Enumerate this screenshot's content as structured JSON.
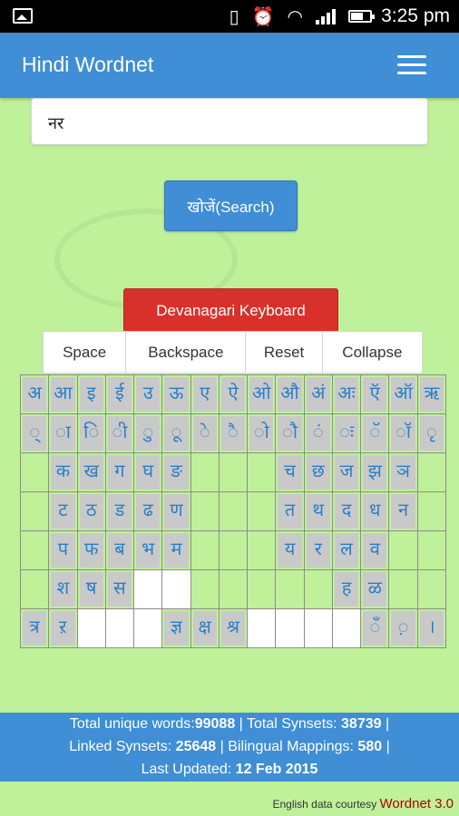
{
  "status_bar": {
    "time": "3:25 pm"
  },
  "app_bar": {
    "title": "Hindi Wordnet"
  },
  "search": {
    "value": "नर",
    "button_label": "खोजें(Search)"
  },
  "keyboard": {
    "toggle_label": "Devanagari Keyboard",
    "actions": [
      "Space",
      "Backspace",
      "Reset",
      "Collapse"
    ],
    "rows": [
      [
        "अ",
        "आ",
        "इ",
        "ई",
        "उ",
        "ऊ",
        "ए",
        "ऐ",
        "ओ",
        "औ",
        "अं",
        "अः",
        "ऍ",
        "ऑ",
        "ऋ"
      ],
      [
        "्",
        "ा",
        "ि",
        "ी",
        "ु",
        "ू",
        "े",
        "ै",
        "ो",
        "ौ",
        "ं",
        "ः",
        "ॅ",
        "ॉ",
        "ृ"
      ],
      [
        "",
        "क",
        "ख",
        "ग",
        "घ",
        "ङ",
        "",
        "",
        "",
        "च",
        "छ",
        "ज",
        "झ",
        "ञ",
        ""
      ],
      [
        "",
        "ट",
        "ठ",
        "ड",
        "ढ",
        "ण",
        "",
        "",
        "",
        "त",
        "थ",
        "द",
        "ध",
        "न",
        ""
      ],
      [
        "",
        "प",
        "फ",
        "ब",
        "भ",
        "म",
        "",
        "",
        "",
        "य",
        "र",
        "ल",
        "व",
        "",
        ""
      ],
      [
        "",
        "श",
        "ष",
        "स",
        "",
        "",
        "",
        "",
        "",
        "",
        "",
        "ह",
        "ळ",
        "",
        ""
      ],
      [
        "त्र",
        "ऱ",
        "",
        "",
        "",
        "ज्ञ",
        "क्ष",
        "श्र",
        "",
        "",
        "",
        "",
        "ँ",
        "़",
        "।"
      ]
    ]
  },
  "stats": {
    "total_words_label": "Total unique words:",
    "total_words": "99088",
    "total_synsets_label": " | Total Synsets: ",
    "total_synsets": "38739",
    "sep1": " |",
    "linked_label": "Linked Synsets: ",
    "linked": "25648",
    "bilingual_label": " | Bilingual Mappings: ",
    "bilingual": "580",
    "sep2": " |",
    "updated_label": "Last Updated: ",
    "updated": "12 Feb 2015"
  },
  "credit": {
    "text": "English data courtesy ",
    "link": "Wordnet 3.0"
  }
}
